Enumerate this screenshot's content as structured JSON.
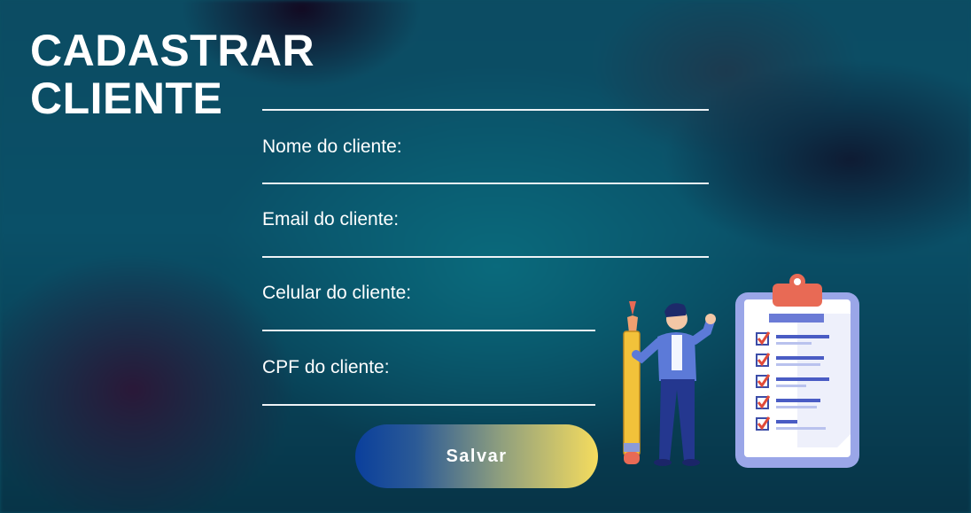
{
  "page": {
    "title_line1": "CADASTRAR",
    "title_line2": "CLIENTE"
  },
  "form": {
    "fields": [
      {
        "label": "Nome do cliente:",
        "value": ""
      },
      {
        "label": "Email do cliente:",
        "value": ""
      },
      {
        "label": "Celular do cliente:",
        "value": ""
      },
      {
        "label": "CPF do cliente:",
        "value": ""
      }
    ],
    "save_label": "Salvar"
  },
  "illustration": {
    "icons": [
      "person-icon",
      "pencil-icon",
      "clipboard-checklist-icon"
    ]
  },
  "colors": {
    "text": "#ffffff",
    "line": "#eef3f6",
    "button_gradient_start": "#0a3f9c",
    "button_gradient_end": "#f5dc5e"
  }
}
